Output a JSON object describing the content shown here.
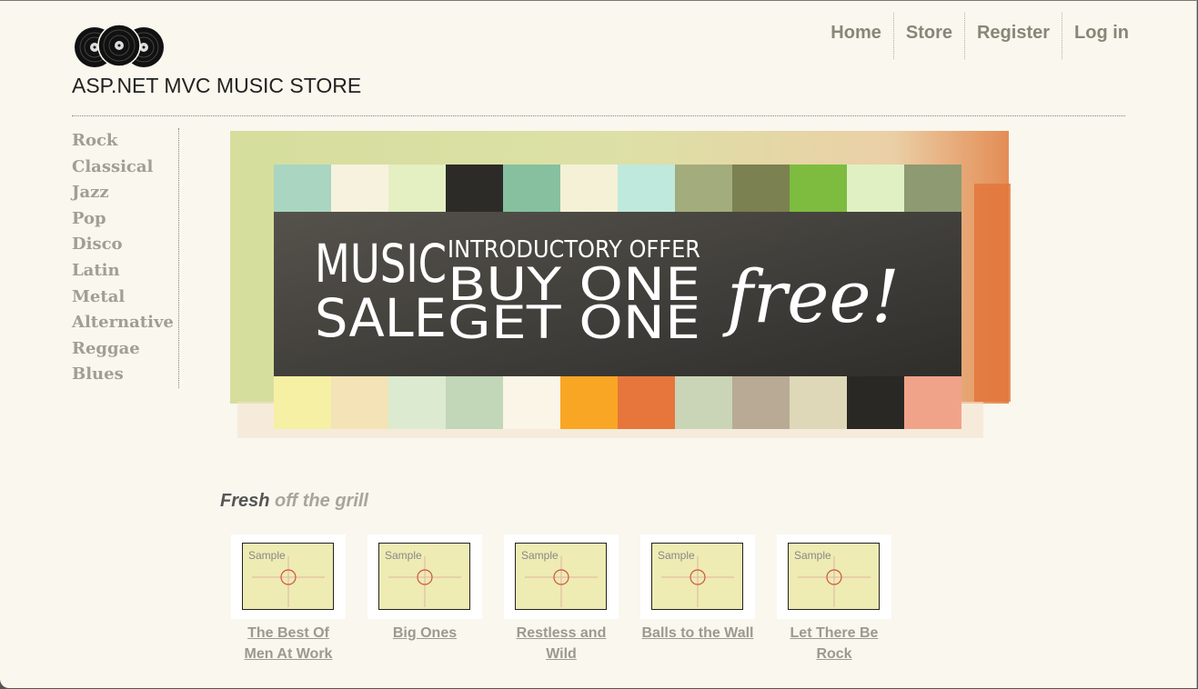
{
  "header": {
    "site_title": "ASP.NET MVC MUSIC STORE",
    "logo_icon": "vinyl-records-logo"
  },
  "nav": {
    "items": [
      "Home",
      "Store",
      "Register",
      "Log in"
    ]
  },
  "sidebar": {
    "genres": [
      "Rock",
      "Classical",
      "Jazz",
      "Pop",
      "Disco",
      "Latin",
      "Metal",
      "Alternative",
      "Reggae",
      "Blues"
    ]
  },
  "banner": {
    "word1": "MUSIC",
    "word2": "SALE",
    "offer": "INTRODUCTORY OFFER",
    "line1": "BUY ONE",
    "line2": "GET ONE",
    "free": "free!"
  },
  "fresh": {
    "bold": "Fresh",
    "rest": "off the grill"
  },
  "albums": [
    {
      "title_line1": "The Best Of",
      "title_line2": "Men At Work",
      "thumb_text": "Sample"
    },
    {
      "title_line1": "Big Ones",
      "title_line2": "",
      "thumb_text": "Sample"
    },
    {
      "title_line1": "Restless and",
      "title_line2": "Wild",
      "thumb_text": "Sample"
    },
    {
      "title_line1": "Balls to the Wall",
      "title_line2": "",
      "thumb_text": "Sample"
    },
    {
      "title_line1": "Let There Be",
      "title_line2": "Rock",
      "thumb_text": "Sample"
    }
  ],
  "colors": {
    "page_bg": "#f9f7ee",
    "nav_text": "#8a8577",
    "sidebar_text": "#a29e93",
    "banner_dark": "#3e3c38"
  }
}
